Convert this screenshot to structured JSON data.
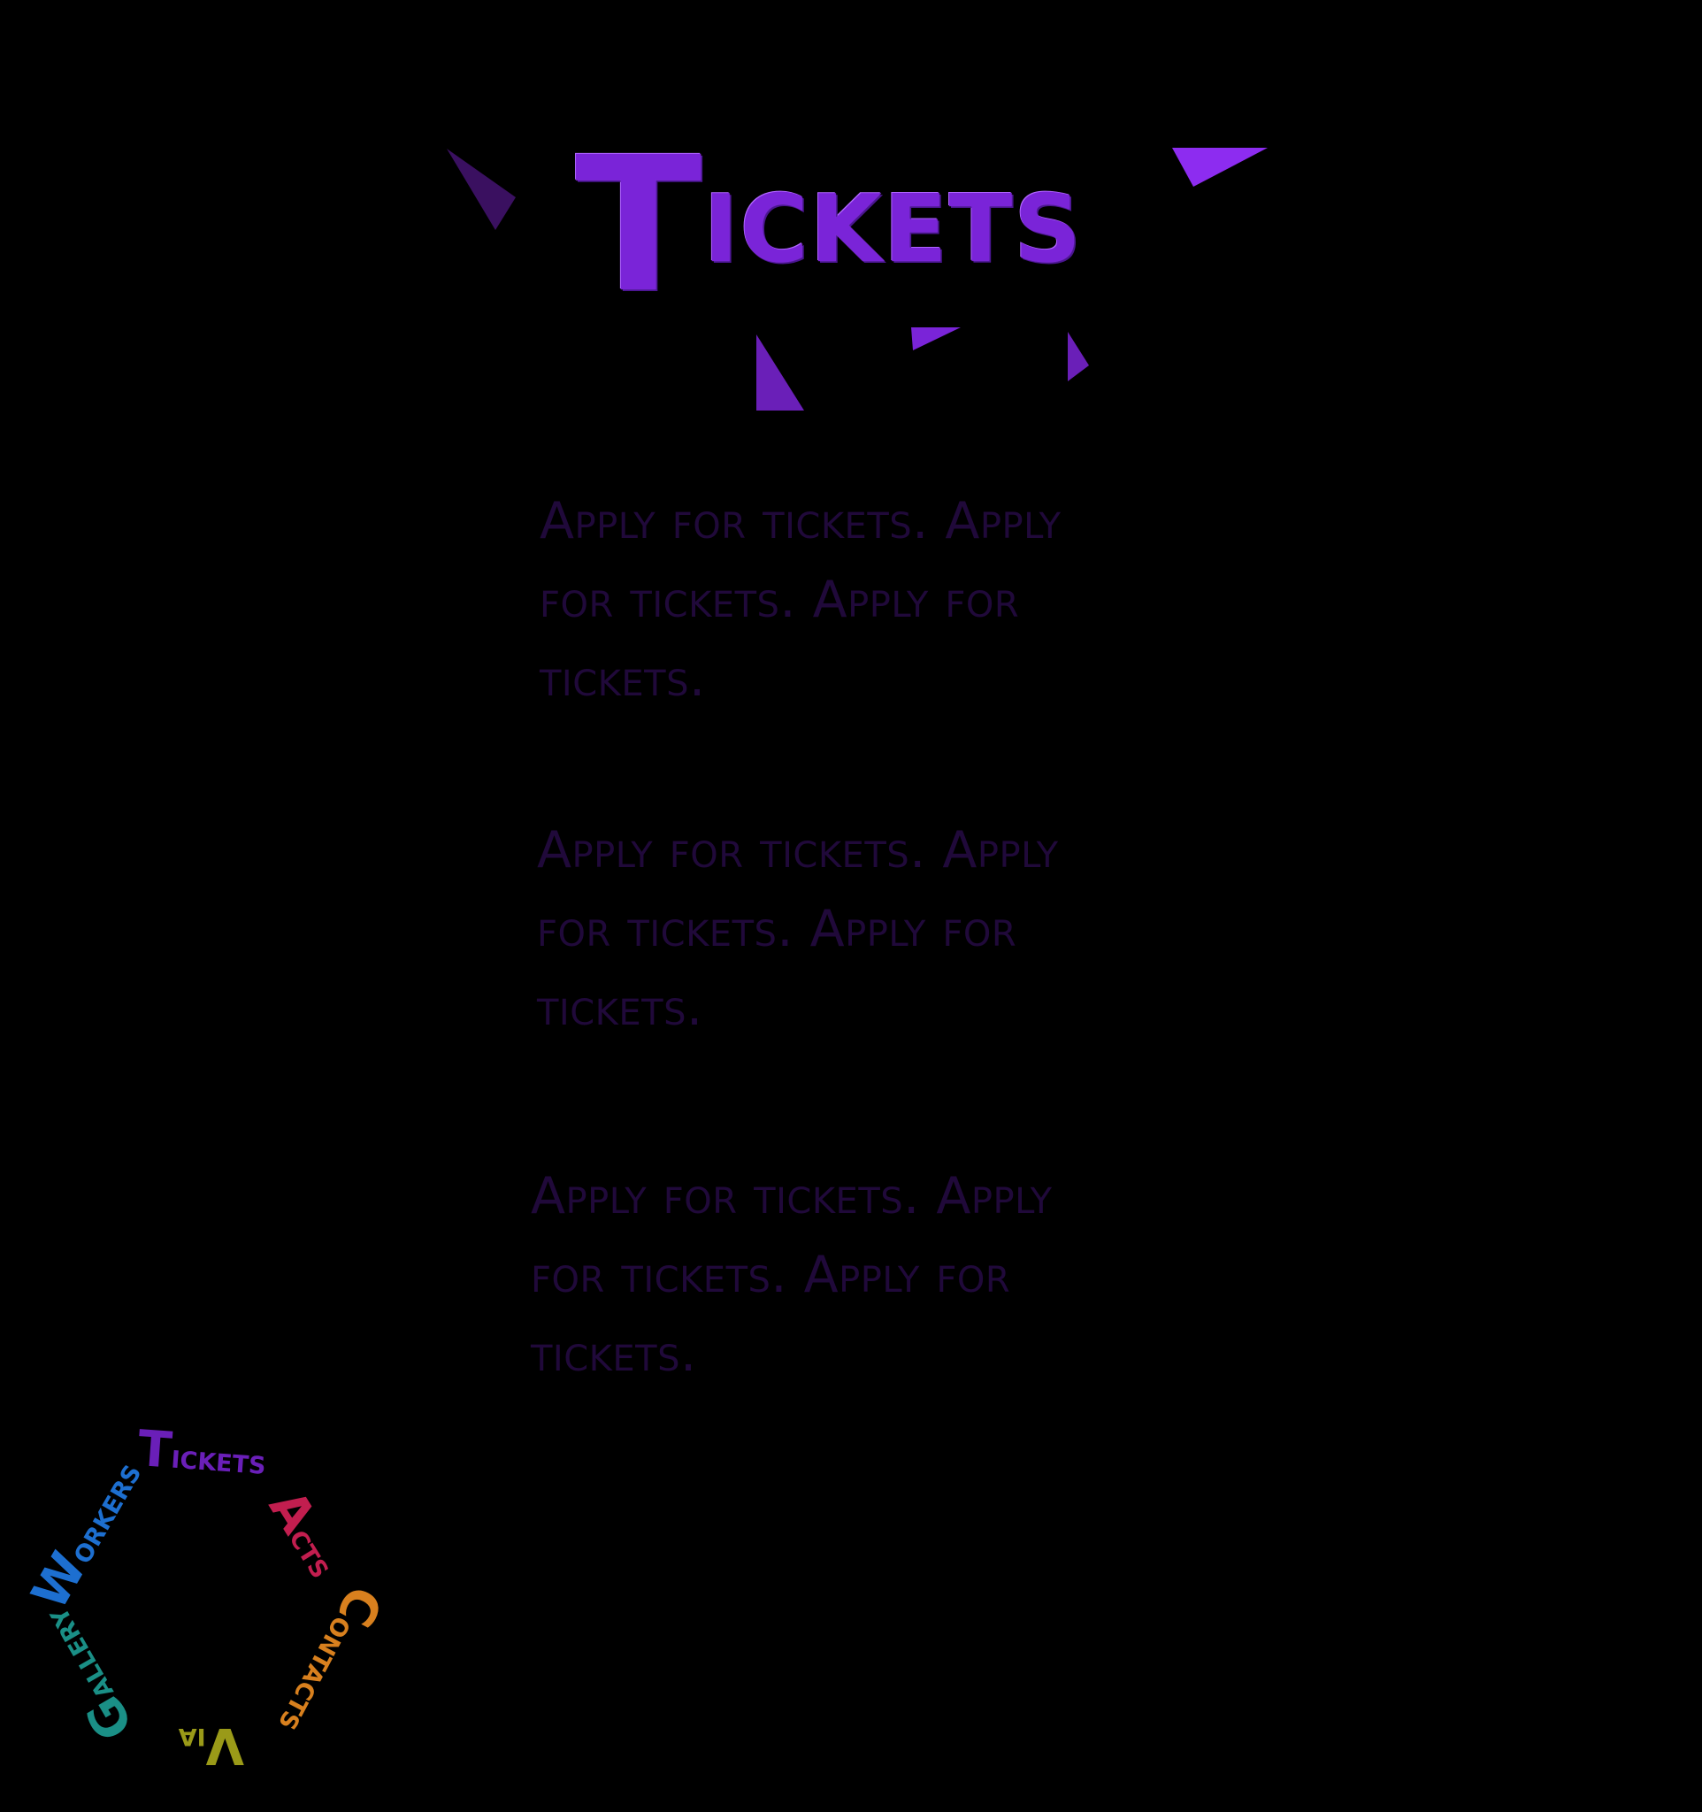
{
  "header": {
    "title_first": "T",
    "title_rest": "ickets"
  },
  "content": {
    "paragraphs": [
      "Apply for tickets. Apply for tickets. Apply for tickets.",
      "Apply for tickets. Apply for tickets. Apply for tickets.",
      "Apply for tickets. Apply for tickets. Apply for tickets."
    ]
  },
  "nav": {
    "tickets": {
      "first": "T",
      "rest": "ickets"
    },
    "acts": {
      "first": "A",
      "rest": "cts"
    },
    "contacts": {
      "first": "C",
      "rest": "ontacts"
    },
    "via": {
      "first": "V",
      "rest": "ia"
    },
    "gallery": {
      "first": "G",
      "rest": "allery"
    },
    "workers": {
      "first": "W",
      "rest": "orkers"
    }
  },
  "colors": {
    "background": "#000000",
    "title_purple": "#7a24d8",
    "paragraph_text": "#20093a",
    "nav_tickets": "#6a1fb8",
    "nav_acts": "#c21e4f",
    "nav_contacts": "#d8801e",
    "nav_via": "#9a9a18",
    "nav_gallery": "#1a8f86",
    "nav_workers": "#1d6fd0"
  }
}
